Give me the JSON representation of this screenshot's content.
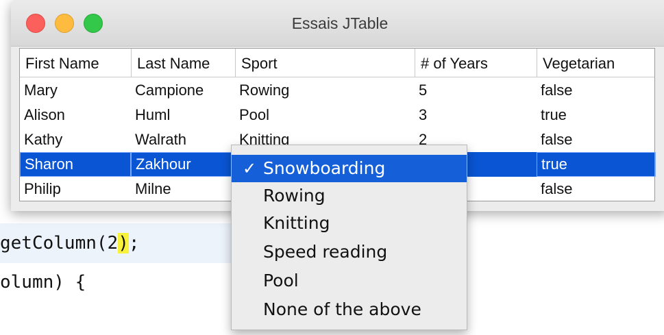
{
  "window": {
    "title": "Essais JTable"
  },
  "table": {
    "columns": [
      "First Name",
      "Last Name",
      "Sport",
      "# of Years",
      "Vegetarian"
    ],
    "rows": [
      [
        "Mary",
        "Campione",
        "Rowing",
        "5",
        "false"
      ],
      [
        "Alison",
        "Huml",
        "Pool",
        "3",
        "true"
      ],
      [
        "Kathy",
        "Walrath",
        "Knitting",
        "2",
        "false"
      ],
      [
        "Sharon",
        "Zakhour",
        "",
        "",
        "true"
      ],
      [
        "Philip",
        "Milne",
        "",
        "",
        "false"
      ]
    ],
    "selected_row": 3
  },
  "dropdown": {
    "check_mark": "✓",
    "options": [
      "Snowboarding",
      "Rowing",
      "Knitting",
      "Speed reading",
      "Pool",
      "None of the above"
    ],
    "selected": "Snowboarding"
  },
  "code": {
    "line1_prefix": "getColumn(2",
    "line1_paren": ")",
    "line1_suffix": ";",
    "line2": "olumn) {"
  },
  "colors": {
    "selection": "#0a55d3",
    "menu_highlight": "#1560d8",
    "bracket_highlight": "#f8f23a"
  }
}
